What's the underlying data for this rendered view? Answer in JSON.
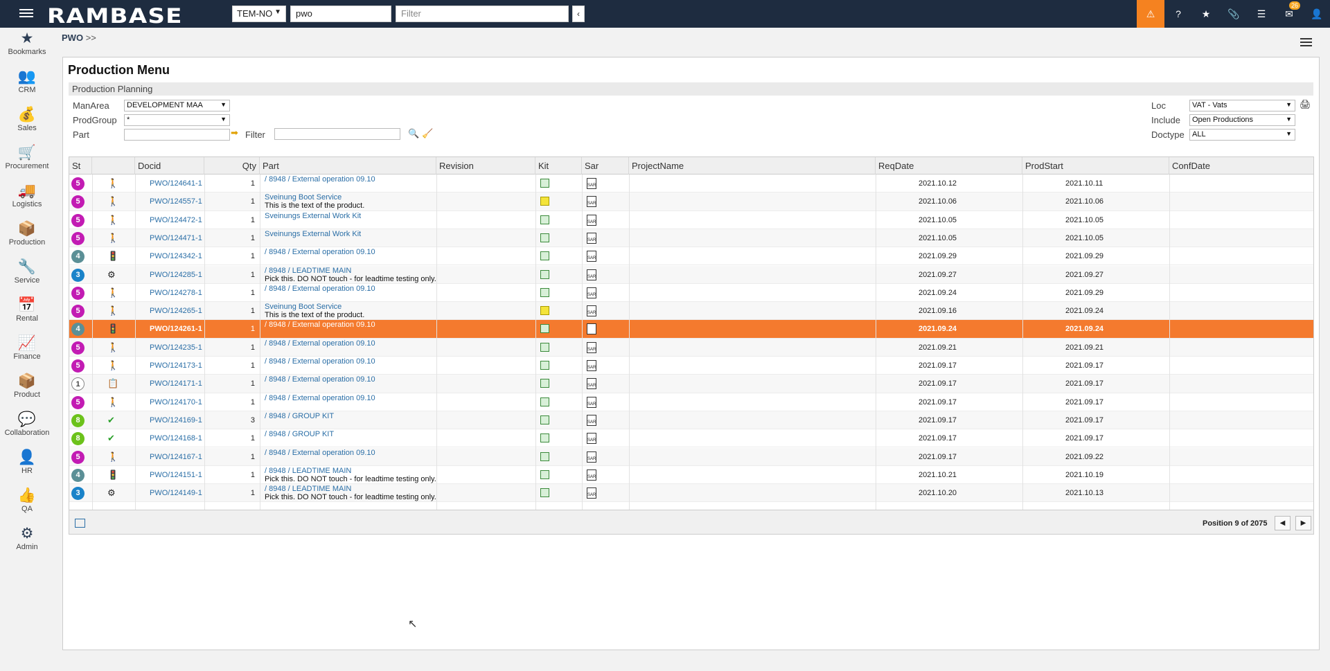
{
  "topbar": {
    "logo": "RAMBASE",
    "company": "TEM-NO",
    "search_value": "pwo",
    "filter_placeholder": "Filter",
    "collapse_glyph": "‹",
    "notification_count": "26",
    "icons": [
      "alert-icon",
      "help-icon",
      "star-icon",
      "paperclip-icon",
      "list-icon",
      "mail-icon",
      "user-icon"
    ]
  },
  "sidenav": [
    {
      "label": "Bookmarks",
      "icon": "★"
    },
    {
      "label": "CRM",
      "icon": "👥"
    },
    {
      "label": "Sales",
      "icon": "💰"
    },
    {
      "label": "Procurement",
      "icon": "🛒"
    },
    {
      "label": "Logistics",
      "icon": "🚚"
    },
    {
      "label": "Production",
      "icon": "📦"
    },
    {
      "label": "Service",
      "icon": "🔧"
    },
    {
      "label": "Rental",
      "icon": "📅"
    },
    {
      "label": "Finance",
      "icon": "📈"
    },
    {
      "label": "Product",
      "icon": "📦"
    },
    {
      "label": "Collaboration",
      "icon": "💬"
    },
    {
      "label": "HR",
      "icon": "👤"
    },
    {
      "label": "QA",
      "icon": "👍"
    },
    {
      "label": "Admin",
      "icon": "⚙"
    }
  ],
  "breadcrumb": {
    "item": "PWO",
    "sep": ">>"
  },
  "panel": {
    "title": "Production Menu",
    "section": "Production Planning",
    "manarea_label": "ManArea",
    "manarea_value": "DEVELOPMENT MAA",
    "prodgroup_label": "ProdGroup",
    "prodgroup_value": "*",
    "part_label": "Part",
    "filter_label": "Filter",
    "loc_label": "Loc",
    "loc_value": "VAT - Vats",
    "include_label": "Include",
    "include_value": "Open Productions",
    "doctype_label": "Doctype",
    "doctype_value": "ALL"
  },
  "grid": {
    "columns": [
      "St",
      "",
      "Docid",
      "Qty",
      "Part",
      "Revision",
      "Kit",
      "Sar",
      "ProjectName",
      "ReqDate",
      "ProdStart",
      "ConfDate"
    ],
    "rows": [
      {
        "st": "5",
        "st_color": "#c21bb3",
        "icon": "🚶",
        "docid": "PWO/124641-1",
        "qty": "1",
        "part": "/ 8948 / External operation 09.10",
        "part2": "",
        "kit": "g",
        "reqdate": "2021.10.12",
        "prodstart": "2021.10.11"
      },
      {
        "st": "5",
        "st_color": "#c21bb3",
        "icon": "🚶",
        "docid": "PWO/124557-1",
        "qty": "1",
        "part": "Sveinung Boot Service",
        "part2": "This is the text of the product.",
        "kit": "y",
        "reqdate": "2021.10.06",
        "prodstart": "2021.10.06"
      },
      {
        "st": "5",
        "st_color": "#c21bb3",
        "icon": "🚶",
        "docid": "PWO/124472-1",
        "qty": "1",
        "part": "Sveinungs External Work Kit",
        "part2": "",
        "kit": "g",
        "reqdate": "2021.10.05",
        "prodstart": "2021.10.05"
      },
      {
        "st": "5",
        "st_color": "#c21bb3",
        "icon": "🚶",
        "docid": "PWO/124471-1",
        "qty": "1",
        "part": "Sveinungs External Work Kit",
        "part2": "",
        "kit": "g",
        "reqdate": "2021.10.05",
        "prodstart": "2021.10.05"
      },
      {
        "st": "4",
        "st_color": "#5b8f96",
        "icon": "🚦",
        "docid": "PWO/124342-1",
        "qty": "1",
        "part": "/ 8948 / External operation 09.10",
        "part2": "",
        "kit": "g",
        "reqdate": "2021.09.29",
        "prodstart": "2021.09.29"
      },
      {
        "st": "3",
        "st_color": "#1a83c9",
        "icon": "⚙",
        "docid": "PWO/124285-1",
        "qty": "1",
        "part": "/ 8948 / LEADTIME MAIN",
        "part2": "Pick this. DO NOT touch - for leadtime testing only.",
        "kit": "g",
        "reqdate": "2021.09.27",
        "prodstart": "2021.09.27"
      },
      {
        "st": "5",
        "st_color": "#c21bb3",
        "icon": "🚶",
        "docid": "PWO/124278-1",
        "qty": "1",
        "part": "/ 8948 / External operation 09.10",
        "part2": "",
        "kit": "g",
        "reqdate": "2021.09.24",
        "prodstart": "2021.09.29"
      },
      {
        "st": "5",
        "st_color": "#c21bb3",
        "icon": "🚶",
        "docid": "PWO/124265-1",
        "qty": "1",
        "part": "Sveinung Boot Service",
        "part2": "This is the text of the product.",
        "kit": "y",
        "reqdate": "2021.09.16",
        "prodstart": "2021.09.24"
      },
      {
        "st": "4",
        "st_color": "#5b8f96",
        "icon": "🚦",
        "docid": "PWO/124261-1",
        "qty": "1",
        "part": "/ 8948 / External operation 09.10",
        "part2": "",
        "kit": "g",
        "reqdate": "2021.09.24",
        "prodstart": "2021.09.24",
        "selected": true
      },
      {
        "st": "5",
        "st_color": "#c21bb3",
        "icon": "🚶",
        "docid": "PWO/124235-1",
        "qty": "1",
        "part": "/ 8948 / External operation 09.10",
        "part2": "",
        "kit": "g",
        "reqdate": "2021.09.21",
        "prodstart": "2021.09.21"
      },
      {
        "st": "5",
        "st_color": "#c21bb3",
        "icon": "🚶",
        "docid": "PWO/124173-1",
        "qty": "1",
        "part": "/ 8948 / External operation 09.10",
        "part2": "",
        "kit": "g",
        "reqdate": "2021.09.17",
        "prodstart": "2021.09.17"
      },
      {
        "st": "1",
        "st_color": "outline",
        "icon": "📋",
        "docid": "PWO/124171-1",
        "qty": "1",
        "part": "/ 8948 / External operation 09.10",
        "part2": "",
        "kit": "g",
        "reqdate": "2021.09.17",
        "prodstart": "2021.09.17"
      },
      {
        "st": "5",
        "st_color": "#c21bb3",
        "icon": "🚶",
        "docid": "PWO/124170-1",
        "qty": "1",
        "part": "/ 8948 / External operation 09.10",
        "part2": "",
        "kit": "g",
        "reqdate": "2021.09.17",
        "prodstart": "2021.09.17"
      },
      {
        "st": "8",
        "st_color": "#6cc21b",
        "icon": "✔",
        "docid": "PWO/124169-1",
        "qty": "3",
        "part": "/ 8948 / GROUP KIT",
        "part2": "",
        "kit": "g",
        "reqdate": "2021.09.17",
        "prodstart": "2021.09.17"
      },
      {
        "st": "8",
        "st_color": "#6cc21b",
        "icon": "✔",
        "docid": "PWO/124168-1",
        "qty": "1",
        "part": "/ 8948 / GROUP KIT",
        "part2": "",
        "kit": "g",
        "reqdate": "2021.09.17",
        "prodstart": "2021.09.17"
      },
      {
        "st": "5",
        "st_color": "#c21bb3",
        "icon": "🚶",
        "docid": "PWO/124167-1",
        "qty": "1",
        "part": "/ 8948 / External operation 09.10",
        "part2": "",
        "kit": "g",
        "reqdate": "2021.09.17",
        "prodstart": "2021.09.22"
      },
      {
        "st": "4",
        "st_color": "#5b8f96",
        "icon": "🚦",
        "docid": "PWO/124151-1",
        "qty": "1",
        "part": "/ 8948 / LEADTIME MAIN",
        "part2": "Pick this. DO NOT touch - for leadtime testing only.",
        "kit": "g",
        "reqdate": "2021.10.21",
        "prodstart": "2021.10.19"
      },
      {
        "st": "3",
        "st_color": "#1a83c9",
        "icon": "⚙",
        "docid": "PWO/124149-1",
        "qty": "1",
        "part": "/ 8948 / LEADTIME MAIN",
        "part2": "Pick this. DO NOT touch - for leadtime testing only.",
        "kit": "g",
        "reqdate": "2021.10.20",
        "prodstart": "2021.10.13"
      }
    ],
    "sar_text": "SAR",
    "position_text": "Position 9 of 2075"
  }
}
